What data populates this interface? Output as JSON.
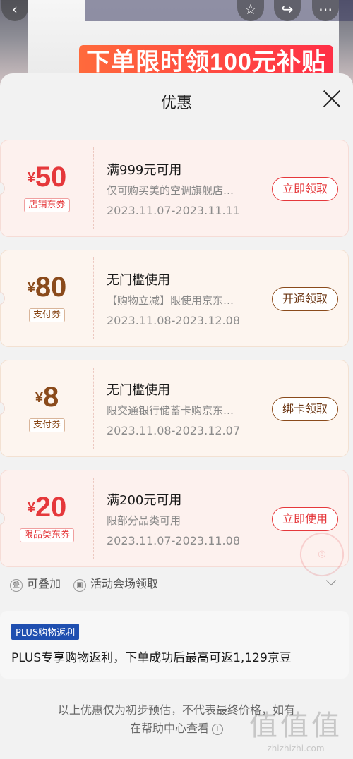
{
  "banner": {
    "promo_text": "下单限时领100元补贴",
    "back_icon": "chevron-left-icon",
    "star_icon": "star-outline-icon",
    "share_icon": "share-icon",
    "more_icon": "more-dots-icon"
  },
  "sheet": {
    "title": "优惠",
    "close_icon": "close-icon"
  },
  "coupons": [
    {
      "currency": "¥",
      "amount": "50",
      "tag": "店铺东券",
      "title": "满999元可用",
      "desc": "仅可购买美的空调旗舰店…",
      "date": "2023.11.07-2023.11.11",
      "button": "立即领取",
      "theme": "red"
    },
    {
      "currency": "¥",
      "amount": "80",
      "tag": "支付券",
      "title": "无门槛使用",
      "desc": "【购物立减】限使用京东…",
      "date": "2023.11.08-2023.12.08",
      "button": "开通领取",
      "theme": "gold"
    },
    {
      "currency": "¥",
      "amount": "8",
      "tag": "支付券",
      "title": "无门槛使用",
      "desc": "限交通银行储蓄卡购京东…",
      "date": "2023.11.08-2023.12.07",
      "button": "绑卡领取",
      "theme": "gold"
    },
    {
      "currency": "¥",
      "amount": "20",
      "tag": "限品类东券",
      "title": "满200元可用",
      "desc": "限部分品类可用",
      "date": "2023.11.07-2023.11.08",
      "button": "立即使用",
      "theme": "red"
    }
  ],
  "stack_row": {
    "stackable": "可叠加",
    "venue": "活动会场领取"
  },
  "plus": {
    "badge": "PLUS购物返利",
    "text": "PLUS专享购物返利，下单成功后最高可返1,129京豆"
  },
  "footer": {
    "line1": "以上优惠仅为初步预估，不代表最终价格，如有",
    "line2": "在帮助中心查看"
  },
  "watermark": {
    "text": "zhizhizhi.com"
  },
  "colors": {
    "red": "#e5383b",
    "gold": "#8a4a1b",
    "plus_blue": "#1f4fb0"
  }
}
